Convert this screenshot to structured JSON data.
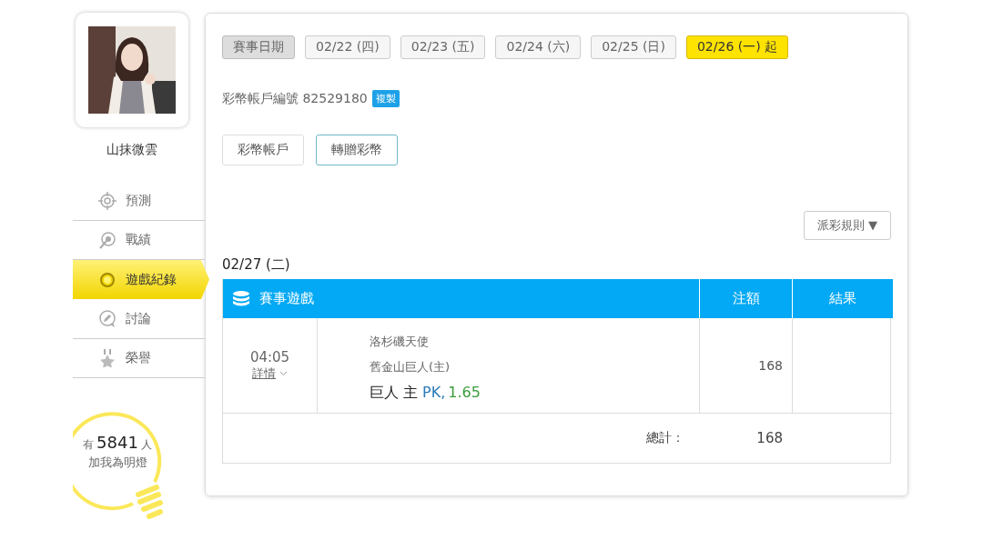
{
  "profile": {
    "name": "山抹微雲"
  },
  "menu": [
    {
      "label": "預測",
      "selected": false
    },
    {
      "label": "戰績",
      "selected": false
    },
    {
      "label": "遊戲紀錄",
      "selected": true
    },
    {
      "label": "討論",
      "selected": false
    },
    {
      "label": "榮譽",
      "selected": false
    }
  ],
  "fans": {
    "prefix": "有",
    "count": "5841",
    "suffix": "人",
    "caption": "加我為明燈"
  },
  "date_filter": {
    "label": "賽事日期",
    "dates": [
      {
        "label": "02/22 (四)",
        "selected": false
      },
      {
        "label": "02/23 (五)",
        "selected": false
      },
      {
        "label": "02/24 (六)",
        "selected": false
      },
      {
        "label": "02/25 (日)",
        "selected": false
      },
      {
        "label": "02/26 (一) 起",
        "selected": true
      }
    ]
  },
  "account": {
    "text": "彩幣帳戶編號 82529180",
    "copy_button": "複製"
  },
  "tabs": [
    {
      "label": "彩幣帳戶",
      "selected": false
    },
    {
      "label": "轉贈彩幣",
      "selected": true
    }
  ],
  "rules_button": "派彩規則 ▼",
  "day_heading": "02/27 (二)",
  "table": {
    "columns": [
      "賽事遊戲",
      "注額",
      "結果"
    ],
    "rows": [
      {
        "time": "04:05",
        "details": "詳情",
        "away": "洛杉磯天使",
        "home": "舊金山巨人(主)",
        "pick_team": "巨人 主",
        "pick_line": "PK,",
        "pick_odds": "1.65",
        "stake": "168"
      }
    ],
    "total_label": "總計：",
    "total": "168"
  }
}
